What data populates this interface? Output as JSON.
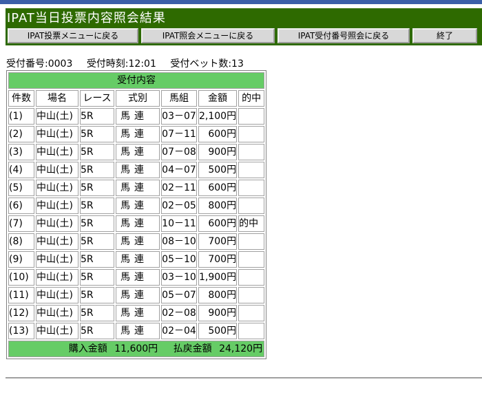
{
  "window": {
    "title": "IPAT当日投票内容照会結果"
  },
  "nav": {
    "buttons": [
      {
        "label": "IPAT投票メニューに戻る"
      },
      {
        "label": "IPAT照会メニューに戻る"
      },
      {
        "label": "IPAT受付番号照会に戻る"
      },
      {
        "label": "終了"
      }
    ]
  },
  "summary": {
    "receipt_no": "受付番号:0003",
    "receipt_time": "受付時刻:12:01",
    "bet_count": "受付ベット数:13"
  },
  "table": {
    "caption": "受付内容",
    "headers": [
      "件数",
      "場名",
      "レース",
      "式別",
      "馬組",
      "金額",
      "的中"
    ],
    "rows": [
      {
        "no": "(1)",
        "place": "中山(土)",
        "race": "5R",
        "type": "馬連",
        "combo": "03－07",
        "amount": "2,100円",
        "hit": ""
      },
      {
        "no": "(2)",
        "place": "中山(土)",
        "race": "5R",
        "type": "馬連",
        "combo": "07－11",
        "amount": "600円",
        "hit": ""
      },
      {
        "no": "(3)",
        "place": "中山(土)",
        "race": "5R",
        "type": "馬連",
        "combo": "07－08",
        "amount": "900円",
        "hit": ""
      },
      {
        "no": "(4)",
        "place": "中山(土)",
        "race": "5R",
        "type": "馬連",
        "combo": "04－07",
        "amount": "500円",
        "hit": ""
      },
      {
        "no": "(5)",
        "place": "中山(土)",
        "race": "5R",
        "type": "馬連",
        "combo": "02－11",
        "amount": "600円",
        "hit": ""
      },
      {
        "no": "(6)",
        "place": "中山(土)",
        "race": "5R",
        "type": "馬連",
        "combo": "02－05",
        "amount": "800円",
        "hit": ""
      },
      {
        "no": "(7)",
        "place": "中山(土)",
        "race": "5R",
        "type": "馬連",
        "combo": "10－11",
        "amount": "600円",
        "hit": "的中"
      },
      {
        "no": "(8)",
        "place": "中山(土)",
        "race": "5R",
        "type": "馬連",
        "combo": "08－10",
        "amount": "700円",
        "hit": ""
      },
      {
        "no": "(9)",
        "place": "中山(土)",
        "race": "5R",
        "type": "馬連",
        "combo": "05－10",
        "amount": "700円",
        "hit": ""
      },
      {
        "no": "(10)",
        "place": "中山(土)",
        "race": "5R",
        "type": "馬連",
        "combo": "03－10",
        "amount": "1,900円",
        "hit": ""
      },
      {
        "no": "(11)",
        "place": "中山(土)",
        "race": "5R",
        "type": "馬連",
        "combo": "05－07",
        "amount": "800円",
        "hit": ""
      },
      {
        "no": "(12)",
        "place": "中山(土)",
        "race": "5R",
        "type": "馬連",
        "combo": "02－08",
        "amount": "900円",
        "hit": ""
      },
      {
        "no": "(13)",
        "place": "中山(土)",
        "race": "5R",
        "type": "馬連",
        "combo": "02－04",
        "amount": "500円",
        "hit": ""
      }
    ],
    "totals": {
      "purchase_label": "購入金額",
      "purchase_amount": "11,600円",
      "refund_label": "払戻金額",
      "refund_amount": "24,120円"
    }
  },
  "colors": {
    "header_bg": "#2e6a00",
    "table_accent": "#66cc66",
    "button_bg": "#d8d8d8",
    "top_bar": "#3b5fa8"
  }
}
